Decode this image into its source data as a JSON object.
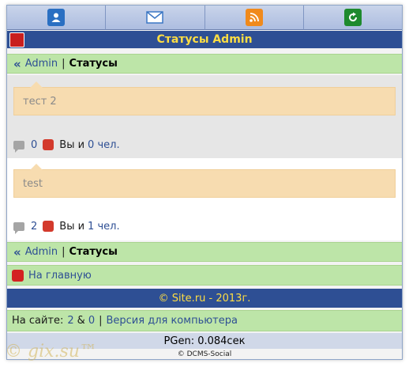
{
  "nav": {
    "buttons": [
      {
        "icon": "user-icon"
      },
      {
        "icon": "mail-icon"
      },
      {
        "icon": "rss-icon"
      },
      {
        "icon": "refresh-icon"
      }
    ]
  },
  "title": "Статусы Admin",
  "breadcrumb": {
    "raquo": "«",
    "user": "Admin",
    "sep": "|",
    "current": "Статусы"
  },
  "statuses": [
    {
      "text": "тест 2",
      "comments": "0",
      "likes_prefix": "Вы и",
      "likes_count": "0 чел."
    },
    {
      "text": "test",
      "comments": "2",
      "likes_prefix": "Вы и",
      "likes_count": "1 чел."
    }
  ],
  "home_link": "На главную",
  "footer": {
    "copyright": "© Site.ru - 2013г.",
    "online_label": "На сайте:",
    "online_users": "2",
    "amp": "&",
    "online_guests": "0",
    "sep": "|",
    "desktop_link": "Версия для компьютера",
    "pgen": "PGen: 0.084сек",
    "credit": "© DCMS-Social"
  },
  "watermark": "© gix.su™",
  "colors": {
    "header": "#2e4f94",
    "title": "#ffde42",
    "green": "#bde5a8",
    "bubble": "#f7dcb0"
  }
}
